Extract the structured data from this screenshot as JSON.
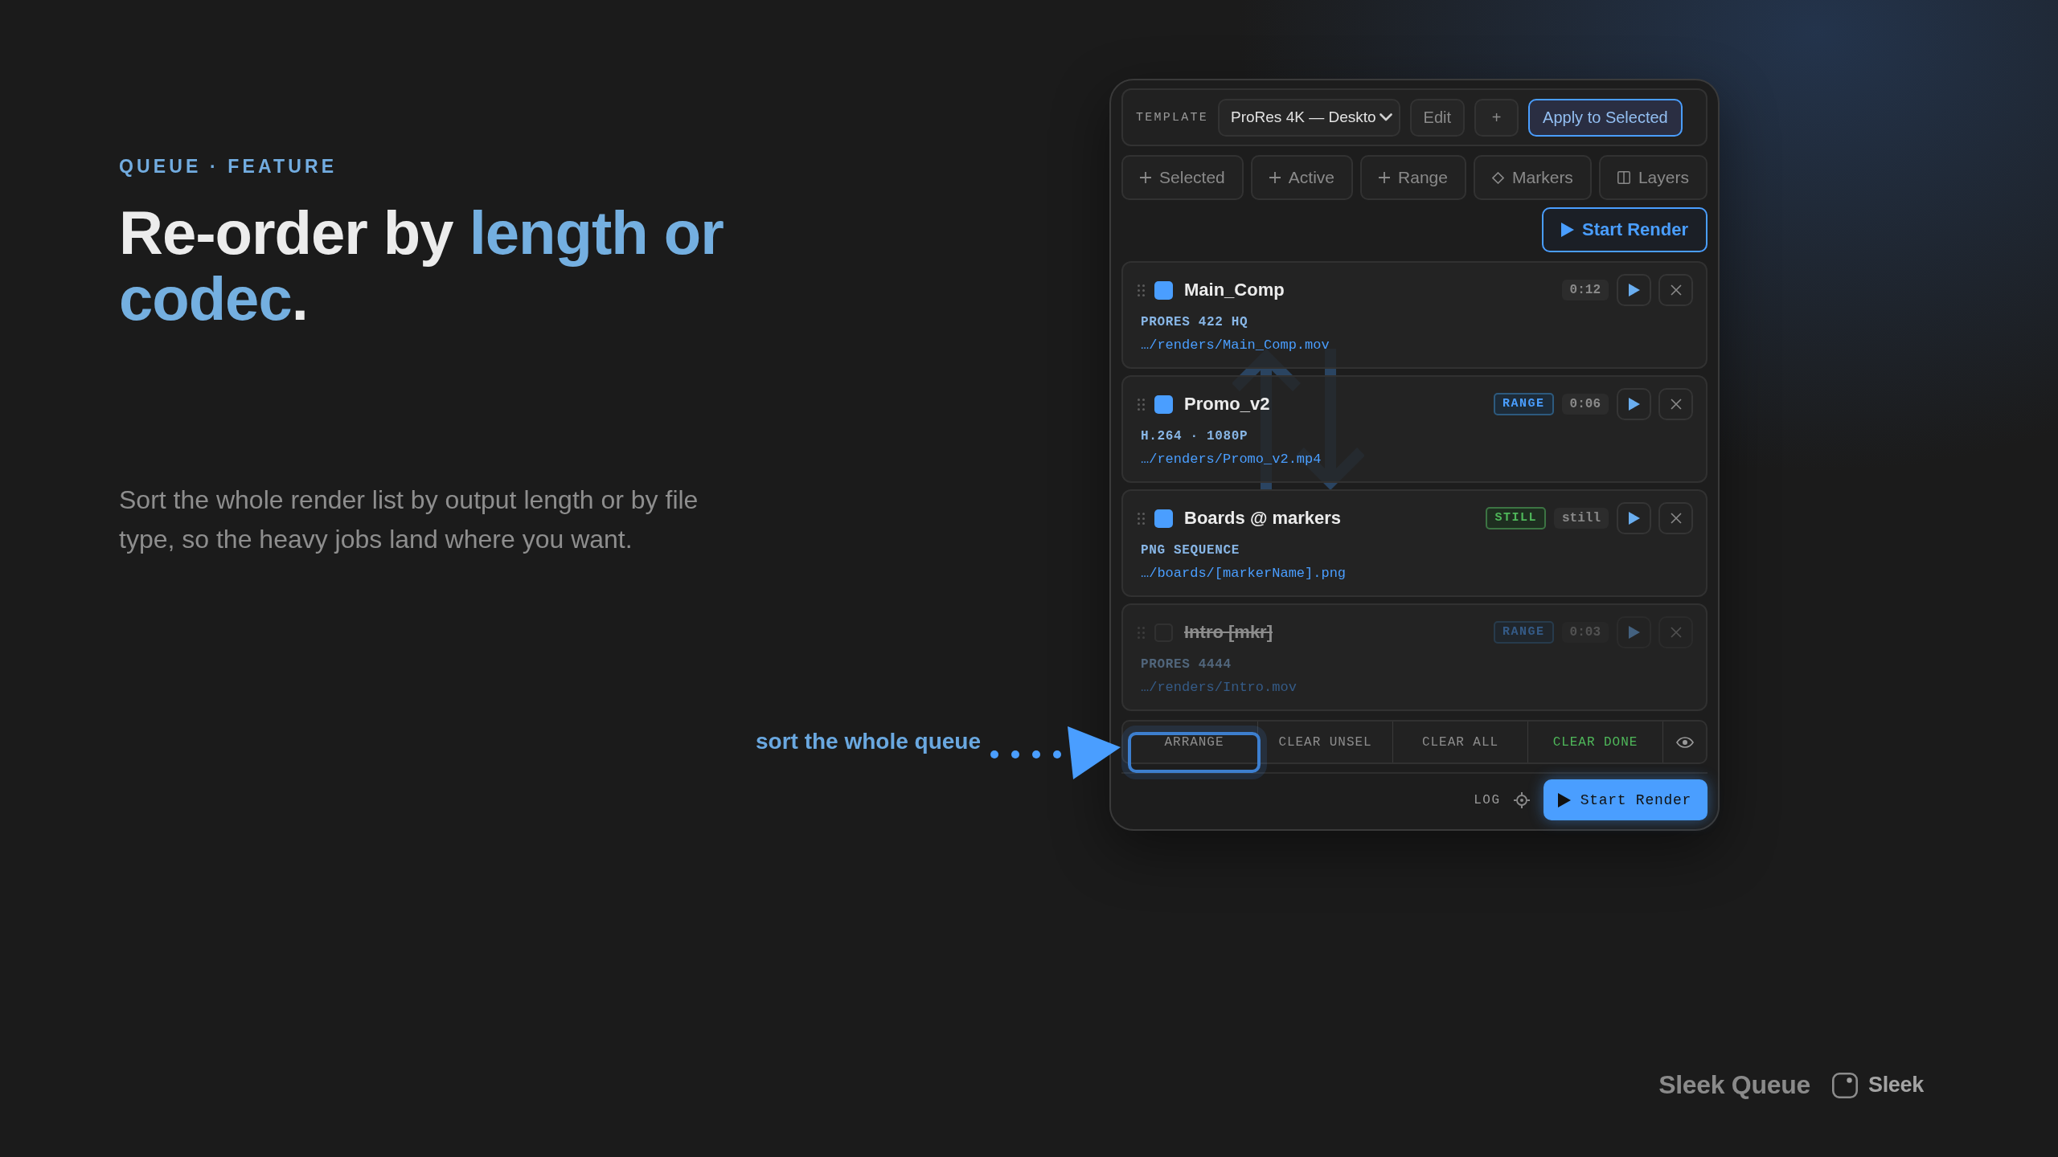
{
  "hero": {
    "eyebrow": "QUEUE · FEATURE",
    "headline": [
      {
        "text": "Re-order by ",
        "highlight": false
      },
      {
        "text": "length or codec",
        "highlight": true
      },
      {
        "text": ".",
        "highlight": false
      }
    ],
    "description": "Sort the whole render list by output length or by file type, so the heavy jobs land where you want."
  },
  "panel": {
    "template": {
      "label": "TEMPLATE",
      "value": "ProRes 4K — Deskto",
      "buttons": [
        {
          "label": "Edit",
          "kind": "edit"
        },
        {
          "label": "+",
          "kind": "add"
        },
        {
          "label": "Apply to Selected",
          "kind": "apply"
        }
      ]
    },
    "add_buttons": [
      {
        "label": "Selected",
        "kind": "add"
      },
      {
        "label": "Active",
        "kind": "add"
      },
      {
        "label": "Range",
        "kind": "add"
      },
      {
        "label": "Markers",
        "kind": "markers"
      },
      {
        "label": "Layers",
        "kind": "layers"
      }
    ],
    "start_button": {
      "label": "Start Render"
    },
    "jobs": [
      {
        "name": "Main_Comp",
        "checked": true,
        "disabled": false,
        "duration": "0:12",
        "codec": "PRORES 422 HQ",
        "path": "…/renders/Main_Comp.mov"
      },
      {
        "name": "Promo_v2",
        "checked": true,
        "disabled": false,
        "tag": {
          "label": "RANGE",
          "kind": "range"
        },
        "duration": "0:06",
        "codec": "H.264 · 1080P",
        "path": "…/renders/Promo_v2.mp4"
      },
      {
        "name": "Boards @ markers",
        "checked": true,
        "disabled": false,
        "tag": {
          "label": "STILL",
          "kind": "still"
        },
        "duration": "still",
        "codec": "PNG SEQUENCE",
        "path": "…/boards/[markerName].png"
      },
      {
        "name": "Intro [mkr]",
        "checked": false,
        "disabled": true,
        "tag": {
          "label": "RANGE",
          "kind": "range"
        },
        "duration": "0:03",
        "codec": "PRORES 4444",
        "path": "…/renders/Intro.mov"
      }
    ],
    "toolbar": {
      "actions": [
        {
          "label": "ARRANGE",
          "kind": "action",
          "highlighted": true
        },
        {
          "label": "CLEAR UNSEL",
          "kind": "action",
          "highlighted": false
        },
        {
          "label": "CLEAR ALL",
          "kind": "action",
          "highlighted": false
        },
        {
          "label": "CLEAR DONE",
          "kind": "success",
          "highlighted": false
        },
        {
          "kind": "eye",
          "highlighted": false
        }
      ]
    },
    "footer": {
      "log_label": "LOG",
      "start_button": {
        "label": "Start Render"
      }
    }
  },
  "callout": {
    "text": "sort the whole queue"
  },
  "brand": {
    "product": "Sleek Queue",
    "logo_text": "Sleek"
  }
}
